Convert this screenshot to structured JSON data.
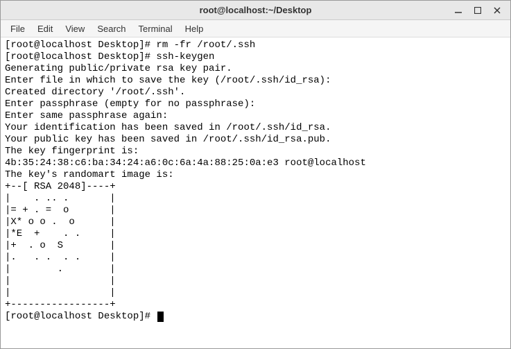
{
  "window": {
    "title": "root@localhost:~/Desktop"
  },
  "menubar": {
    "items": [
      "File",
      "Edit",
      "View",
      "Search",
      "Terminal",
      "Help"
    ]
  },
  "terminal": {
    "lines": [
      "[root@localhost Desktop]# rm -fr /root/.ssh",
      "[root@localhost Desktop]# ssh-keygen",
      "Generating public/private rsa key pair.",
      "Enter file in which to save the key (/root/.ssh/id_rsa):",
      "Created directory '/root/.ssh'.",
      "Enter passphrase (empty for no passphrase):",
      "Enter same passphrase again:",
      "Your identification has been saved in /root/.ssh/id_rsa.",
      "Your public key has been saved in /root/.ssh/id_rsa.pub.",
      "The key fingerprint is:",
      "4b:35:24:38:c6:ba:34:24:a6:0c:6a:4a:88:25:0a:e3 root@localhost",
      "The key's randomart image is:",
      "+--[ RSA 2048]----+",
      "|    . .. .       |",
      "|= + . =  o       |",
      "|X* o o .  o      |",
      "|*E  +    . .     |",
      "|+  . o  S        |",
      "|.   . .  . .     |",
      "|        .        |",
      "|                 |",
      "|                 |",
      "+-----------------+"
    ],
    "prompt": "[root@localhost Desktop]# "
  }
}
